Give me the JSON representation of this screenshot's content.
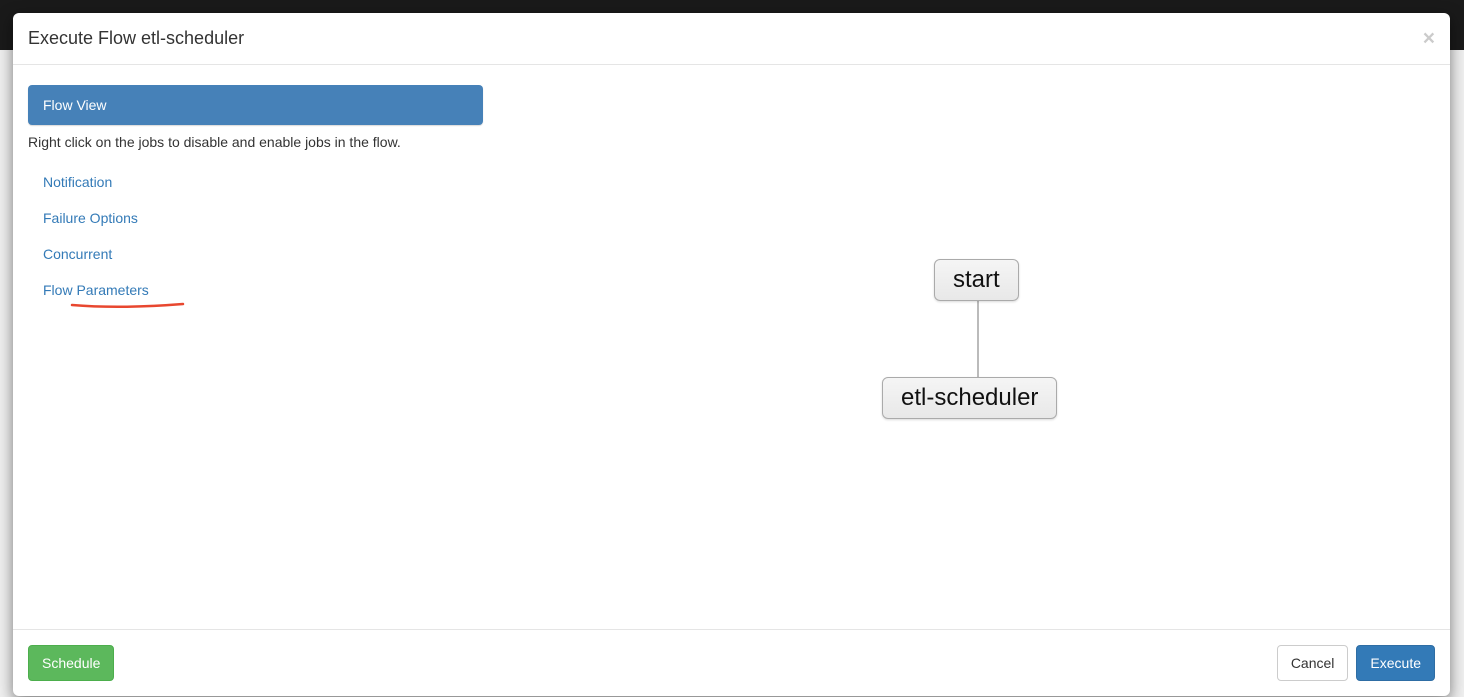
{
  "modal": {
    "title": "Execute Flow etl-scheduler"
  },
  "sidepanel": {
    "active_tab": "Flow View",
    "active_help": "Right click on the jobs to disable and enable jobs in the flow.",
    "links": {
      "notification": "Notification",
      "failure": "Failure Options",
      "concurrent": "Concurrent",
      "flow_params": "Flow Parameters"
    }
  },
  "graph": {
    "nodes": {
      "start": "start",
      "etl": "etl-scheduler"
    }
  },
  "footer": {
    "schedule": "Schedule",
    "cancel": "Cancel",
    "execute": "Execute"
  }
}
